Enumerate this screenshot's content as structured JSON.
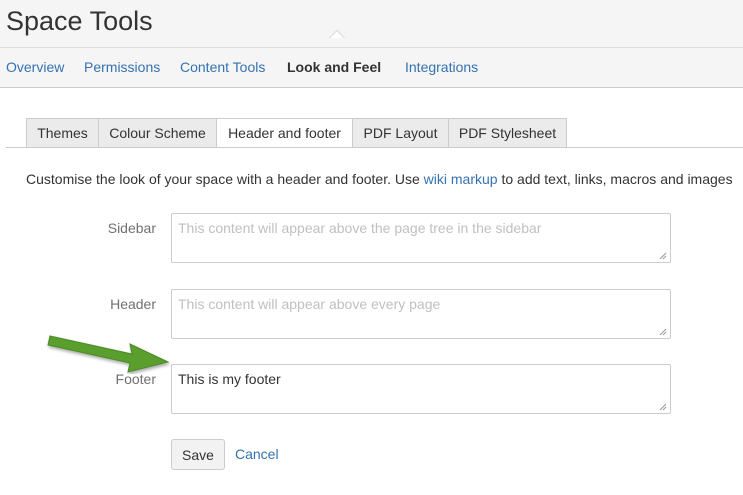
{
  "page": {
    "title": "Space Tools"
  },
  "nav": {
    "items": [
      {
        "label": "Overview"
      },
      {
        "label": "Permissions"
      },
      {
        "label": "Content Tools"
      },
      {
        "label": "Look and Feel"
      },
      {
        "label": "Integrations"
      }
    ],
    "active": "Look and Feel"
  },
  "tabs": {
    "items": [
      {
        "label": "Themes"
      },
      {
        "label": "Colour Scheme"
      },
      {
        "label": "Header and footer"
      },
      {
        "label": "PDF Layout"
      },
      {
        "label": "PDF Stylesheet"
      }
    ],
    "active": "Header and footer"
  },
  "description": {
    "before_link": "Customise the look of your space with a header and footer. Use ",
    "link_text": "wiki markup",
    "after_link": " to add text, links, macros and images"
  },
  "form": {
    "sidebar": {
      "label": "Sidebar",
      "value": "",
      "placeholder": "This content will appear above the page tree in the sidebar"
    },
    "header": {
      "label": "Header",
      "value": "",
      "placeholder": "This content will appear above every page"
    },
    "footer": {
      "label": "Footer",
      "value": "This is my footer",
      "placeholder": ""
    },
    "save_label": "Save",
    "cancel_label": "Cancel"
  },
  "annotation": {
    "arrow_color": "#5a9e2f",
    "arrow_icon": "arrow-right-icon"
  },
  "colors": {
    "link": "#3572b0",
    "text": "#333333",
    "label": "#707070"
  }
}
